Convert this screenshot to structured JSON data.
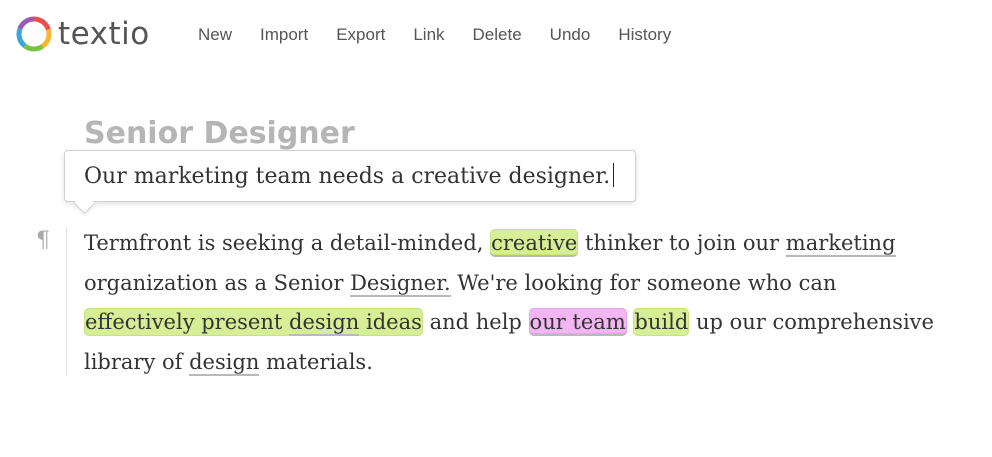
{
  "app": {
    "logo_text": "textio",
    "logo_icon": "textio-ring-logo",
    "logo_colors": [
      "#f04e4e",
      "#f7b733",
      "#7cc242",
      "#3aa6dd",
      "#9b59b6"
    ]
  },
  "toolbar": {
    "items": [
      {
        "label": "New"
      },
      {
        "label": "Import"
      },
      {
        "label": "Export"
      },
      {
        "label": "Link"
      },
      {
        "label": "Delete"
      },
      {
        "label": "Undo"
      },
      {
        "label": "History"
      }
    ]
  },
  "document": {
    "title": "Senior Designer",
    "suggestion_text": "Our marketing team needs a creative designer.",
    "paragraph_marker": "¶",
    "paragraph": {
      "line1": {
        "a": "Termfront is seeking a detail-minded, ",
        "creative": "creative",
        "b": " thinker to join our ",
        "marketing": "marketing"
      },
      "line2": {
        "a": "organization as a Senior ",
        "designer": "Designer.",
        "b": " We're looking for someone who can"
      },
      "line3": {
        "phrase_a": "effectively present ",
        "design": "design",
        "phrase_b": " ideas",
        "b": " and help ",
        "our_team": "our team",
        "c": " ",
        "build": "build",
        "d": " up our comprehensive"
      },
      "line4": {
        "a": "library of ",
        "design": "design",
        "b": " materials."
      }
    },
    "highlight_colors": {
      "positive": "#d6ee95",
      "caution": "#f2b7f2",
      "underline": "#b9b9b9"
    }
  }
}
